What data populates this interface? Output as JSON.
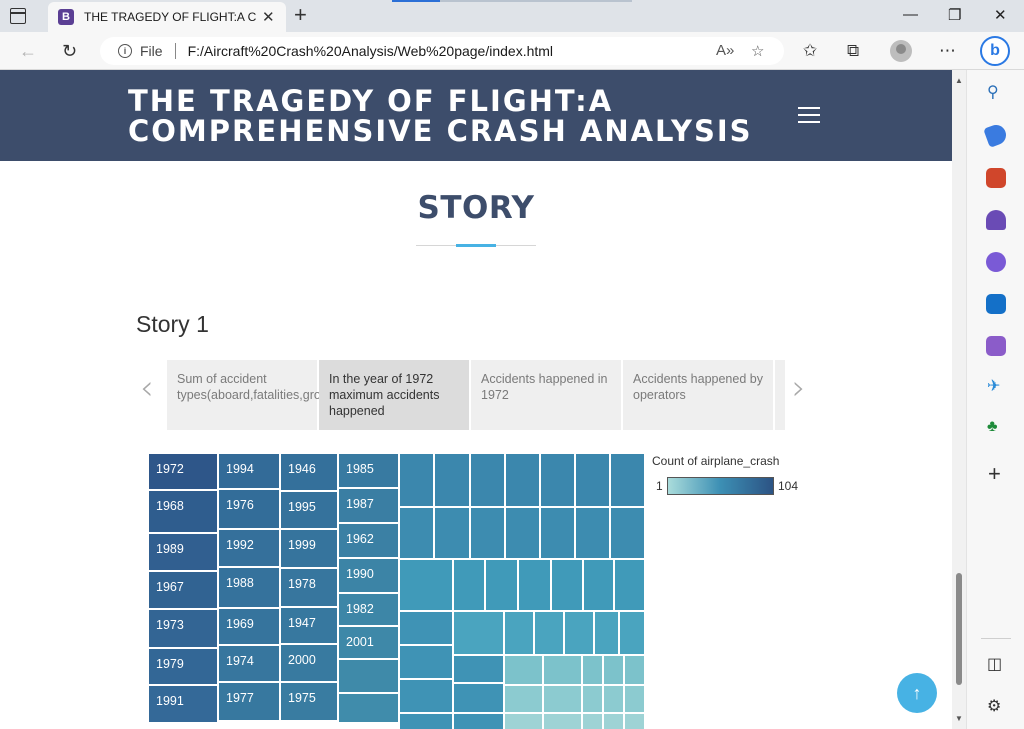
{
  "browser": {
    "tab_title": "THE TRAGEDY OF FLIGHT:A Comprehensive Crash Analysis",
    "tab_favicon": "B",
    "file_label": "File",
    "url": "F:/Aircraft%20Crash%20Analysis/Web%20page/index.html"
  },
  "site": {
    "title_line1": "THE TRAGEDY OF FLIGHT:A",
    "title_line2": "COMPREHENSIVE CRASH ANALYSIS"
  },
  "section": {
    "title": "STORY",
    "story_heading": "Story 1"
  },
  "story_points": [
    {
      "label": "Sum of accident types(aboard,fatalities,ground)"
    },
    {
      "label": "In the year of 1972 maximum accidents happened"
    },
    {
      "label": "Accidents happened in 1972"
    },
    {
      "label": "Accidents happened by operators"
    }
  ],
  "treemap": {
    "labels": [
      "1972",
      "1968",
      "1989",
      "1967",
      "1973",
      "1979",
      "1991",
      "1994",
      "1976",
      "1992",
      "1988",
      "1969",
      "1974",
      "1977",
      "1946",
      "1995",
      "1999",
      "1978",
      "1947",
      "2000",
      "1975",
      "1985",
      "1987",
      "1962",
      "1990",
      "1982",
      "2001"
    ]
  },
  "legend": {
    "title": "Count of airplane_crash",
    "min": "1",
    "max": "104"
  },
  "colors": {
    "header": "#3d4d6b",
    "accent": "#47b2e4"
  }
}
